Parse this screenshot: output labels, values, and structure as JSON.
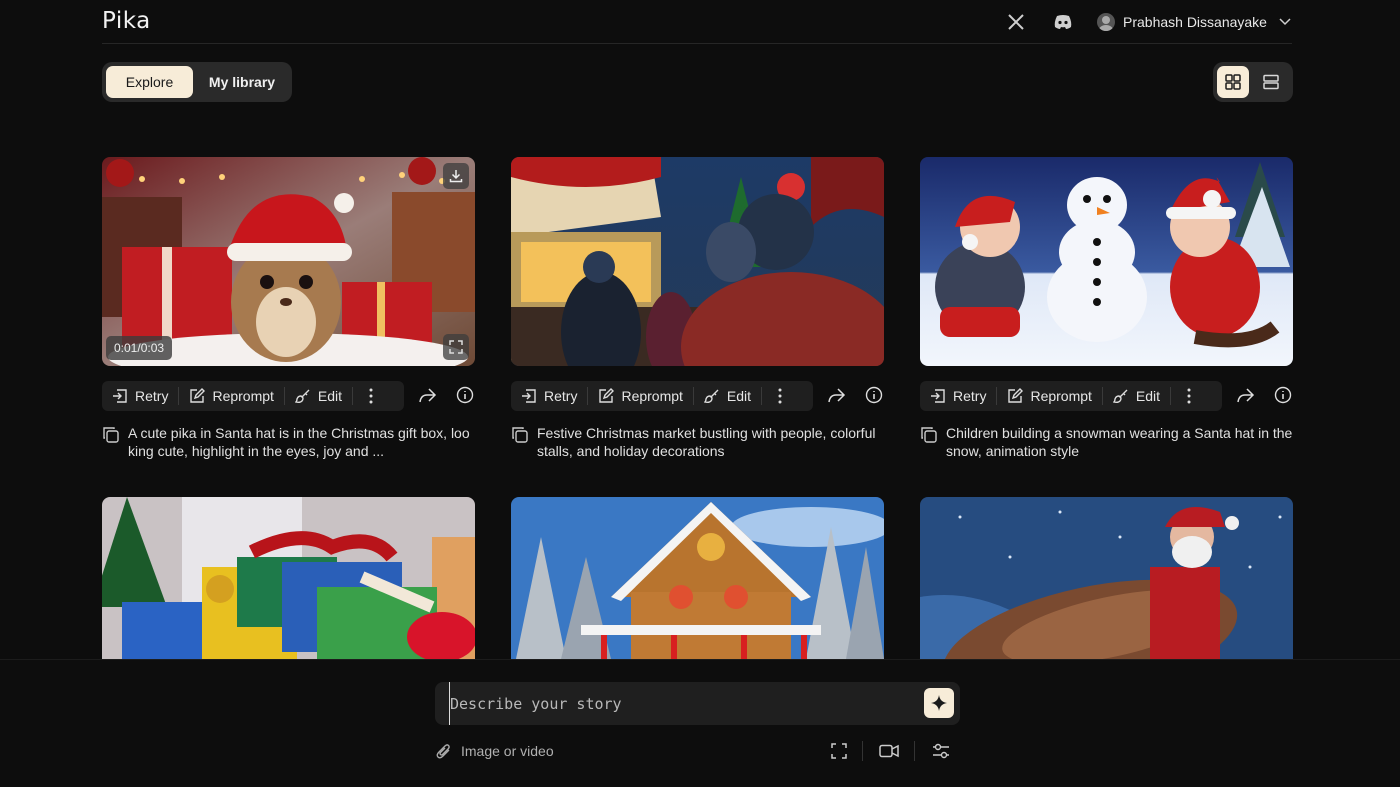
{
  "app": {
    "logo": "Pika"
  },
  "header": {
    "user_name": "Prabhash Dissanayake",
    "icons": [
      "x-icon",
      "discord-icon",
      "avatar",
      "chevron-down-icon"
    ]
  },
  "tabs": [
    {
      "label": "Explore",
      "active": true
    },
    {
      "label": "My library",
      "active": false
    }
  ],
  "view_modes": [
    "grid-view-icon",
    "list-view-icon"
  ],
  "cards": [
    {
      "timecode": "0:01/0:03",
      "prompt": "A cute pika in Santa hat is in the Christmas gift box, looking cute, highlight in the eyes, joy and ...",
      "actions": {
        "retry": "Retry",
        "reprompt": "Reprompt",
        "edit": "Edit"
      }
    },
    {
      "prompt": "Festive Christmas market bustling with people, colorful stalls, and holiday decorations",
      "actions": {
        "retry": "Retry",
        "reprompt": "Reprompt",
        "edit": "Edit"
      }
    },
    {
      "prompt": "Children building a snowman wearing a Santa hat in the snow, animation style",
      "actions": {
        "retry": "Retry",
        "reprompt": "Reprompt",
        "edit": "Edit"
      }
    }
  ],
  "composer": {
    "placeholder": "Describe your story",
    "attach_label": "Image or video"
  },
  "colors": {
    "background": "#0d0d0d",
    "accent": "#f7ecd8",
    "panel": "#1f1f1f"
  }
}
